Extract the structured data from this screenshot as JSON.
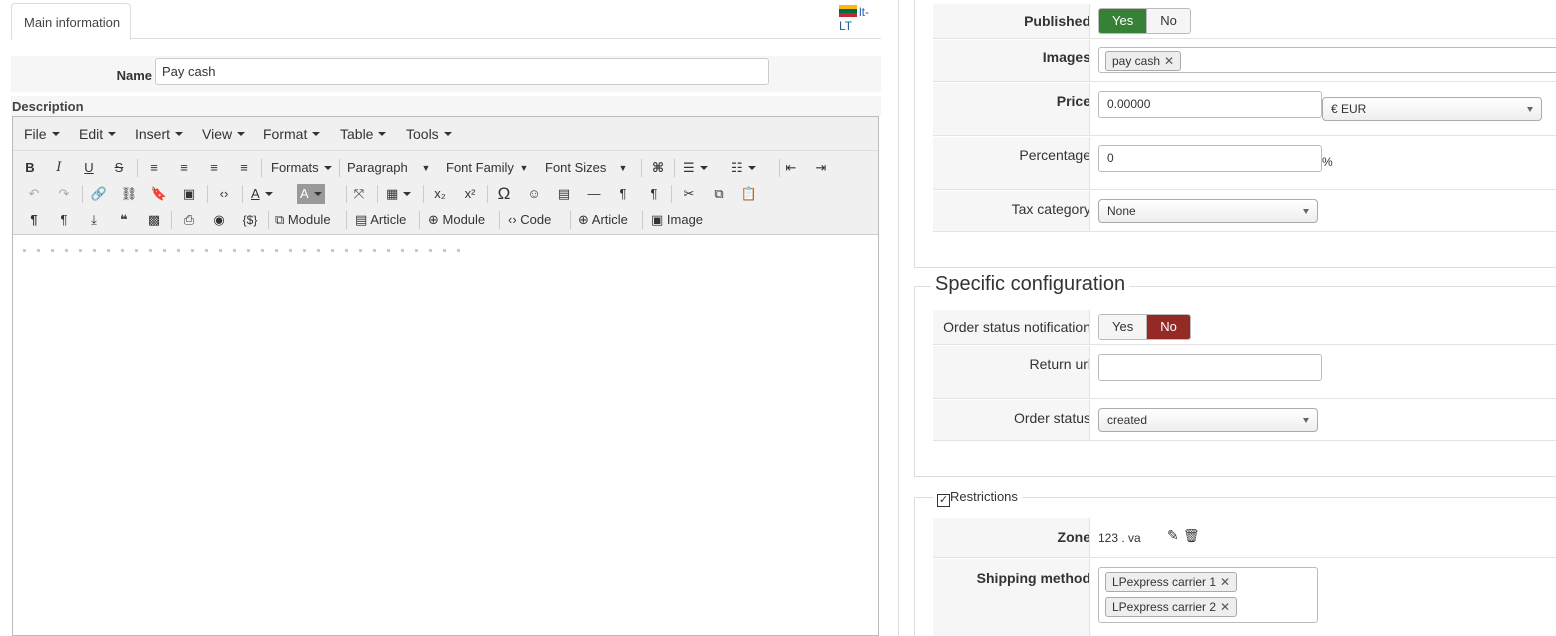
{
  "tabs": {
    "main": "Main information",
    "lang": "lt-LT"
  },
  "form": {
    "name_label": "Name",
    "name_value": "Pay cash",
    "description_label": "Description"
  },
  "editor": {
    "menu": [
      "File",
      "Edit",
      "Insert",
      "View",
      "Format",
      "Table",
      "Tools"
    ],
    "formats": "Formats",
    "paragraph": "Paragraph",
    "font_family": "Font Family",
    "font_sizes": "Font Sizes",
    "row3": {
      "module1": "Module",
      "article1": "Article",
      "module2": "Module",
      "code": "Code",
      "article2": "Article",
      "image": "Image"
    },
    "icons": {
      "bold": "B",
      "italic": "I",
      "underline": "U",
      "strike": "S",
      "sub": "x₂",
      "sup": "x²",
      "omega": "Ω",
      "pilcrow": "¶"
    }
  },
  "general": {
    "published_label": "Published",
    "yes": "Yes",
    "no": "No",
    "images_label": "Images",
    "image_tag": "pay cash",
    "price_label": "Price",
    "price_value": "0.00000",
    "currency": "€ EUR",
    "percentage_label": "Percentage",
    "percentage_value": "0",
    "percent_sign": "%",
    "tax_label": "Tax category",
    "tax_value": "None"
  },
  "specific": {
    "legend": "Specific configuration",
    "notify_label": "Order status notification",
    "yes": "Yes",
    "no": "No",
    "return_label": "Return url",
    "return_value": "",
    "status_label": "Order status",
    "status_value": "created"
  },
  "restrictions": {
    "legend": "Restrictions",
    "zone_label": "Zone",
    "zone_value": "123 .  va",
    "shipping_label": "Shipping method",
    "shipping_tags": [
      "LPexpress carrier 1",
      "LPexpress carrier 2"
    ]
  },
  "colors": {
    "yes_active": "#378137",
    "no_active": "#942a25",
    "link": "#1a5fa8"
  }
}
